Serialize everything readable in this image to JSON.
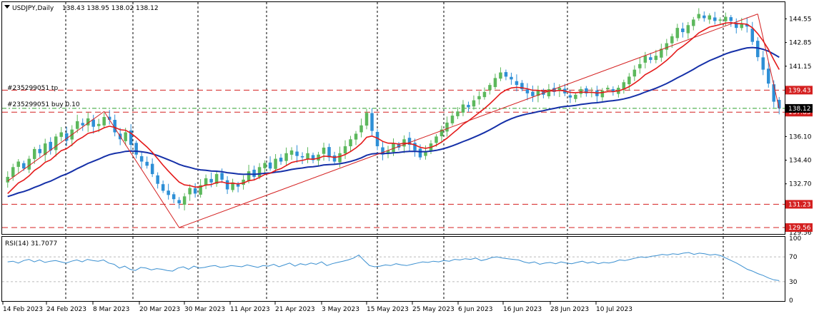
{
  "header": {
    "symbol": "USDJPY,Daily",
    "ohlc": "138.43 138.95 138.02 138.12"
  },
  "orders": {
    "tp_label": "#235299051 tp",
    "buy_label": "#235299051 buy 0.10"
  },
  "colors": {
    "bull": "#5cb85c",
    "bear": "#2e8fd6",
    "ema_fast": "#e41a1a",
    "ema_slow": "#1530a8",
    "trend": "#d42020",
    "level": "#d42020",
    "entry": "#2ca02c",
    "rsi": "#3a8fd0",
    "price_tag_bg": "#d42020"
  },
  "chart_data": [
    {
      "type": "candlestick",
      "symbol": "USDJPY",
      "timeframe": "Daily",
      "y_ticks": [
        "144.55",
        "142.85",
        "141.15",
        "136.10",
        "134.40",
        "132.70"
      ],
      "ylim": [
        129.15,
        145.7
      ],
      "x_labels": [
        "14 Feb 2023",
        "24 Feb 2023",
        "8 Mar 2023",
        "20 Mar 2023",
        "30 Mar 2023",
        "11 Apr 2023",
        "21 Apr 2023",
        "3 May 2023",
        "15 May 2023",
        "25 May 2023",
        "6 Jun 2023",
        "16 Jun 2023",
        "28 Jun 2023",
        "10 Jul 2023"
      ],
      "levels": [
        {
          "label": "139.43",
          "value": 139.43
        },
        {
          "label": "137.85",
          "value": 137.85
        },
        {
          "label": "131.23",
          "value": 131.23
        },
        {
          "label": "129.56",
          "value": 129.56
        }
      ],
      "entry_level": 138.12,
      "current_price": "138.12",
      "grid_label": "129.56",
      "trend_points": [
        {
          "bar": 0,
          "value": 132.9
        },
        {
          "bar": 18,
          "value": 137.9
        },
        {
          "bar": 32,
          "value": 129.56
        },
        {
          "bar": 140,
          "value": 144.9
        },
        {
          "bar": 152,
          "value": 138.1
        }
      ],
      "candles_close": [
        133.2,
        133.9,
        134.3,
        133.8,
        134.5,
        135.2,
        134.9,
        135.6,
        135.1,
        136.1,
        136.4,
        135.8,
        136.6,
        137.2,
        136.9,
        137.4,
        136.8,
        137.0,
        137.5,
        137.3,
        136.4,
        135.9,
        136.4,
        135.5,
        134.8,
        134.3,
        134.0,
        133.4,
        132.7,
        132.2,
        131.9,
        131.6,
        131.3,
        131.8,
        132.4,
        132.0,
        132.6,
        133.1,
        132.8,
        133.4,
        133.0,
        132.3,
        132.8,
        132.5,
        133.0,
        133.6,
        133.2,
        133.9,
        134.2,
        133.8,
        134.5,
        134.3,
        134.9,
        135.1,
        134.7,
        134.6,
        134.9,
        134.4,
        134.8,
        135.3,
        134.6,
        134.3,
        134.9,
        135.4,
        135.9,
        136.3,
        136.9,
        137.8,
        136.5,
        135.4,
        134.8,
        135.1,
        135.6,
        135.3,
        135.9,
        135.5,
        135.1,
        134.6,
        135.0,
        135.6,
        136.1,
        136.6,
        137.1,
        137.6,
        137.9,
        138.4,
        138.2,
        138.7,
        139.0,
        139.3,
        139.8,
        140.3,
        140.7,
        140.4,
        140.2,
        139.8,
        139.5,
        139.2,
        139.0,
        139.4,
        139.1,
        139.5,
        139.3,
        139.6,
        139.2,
        138.9,
        139.1,
        139.5,
        139.2,
        139.3,
        139.0,
        139.4,
        139.6,
        139.3,
        139.6,
        140.0,
        140.4,
        140.9,
        141.3,
        141.9,
        141.6,
        141.9,
        142.4,
        142.8,
        143.3,
        143.9,
        143.6,
        144.1,
        144.5,
        144.9,
        144.6,
        144.8,
        144.4,
        144.5,
        144.7,
        144.4,
        143.9,
        144.2,
        144.0,
        142.9,
        141.8,
        140.9,
        139.9,
        138.6,
        138.12
      ],
      "ema_fast_label": "",
      "ema_slow_label": ""
    },
    {
      "type": "line",
      "name": "RSI(14) 31.7077",
      "y_ticks": [
        "100",
        "70",
        "30",
        "0"
      ],
      "ylim": [
        0,
        100
      ],
      "levels": [
        70,
        30
      ],
      "values": [
        62,
        63,
        60,
        64,
        66,
        62,
        65,
        61,
        63,
        64,
        62,
        60,
        63,
        65,
        62,
        66,
        64,
        63,
        65,
        60,
        58,
        52,
        55,
        50,
        48,
        53,
        52,
        49,
        51,
        50,
        48,
        47,
        52,
        54,
        50,
        55,
        52,
        53,
        55,
        56,
        53,
        54,
        56,
        55,
        54,
        57,
        55,
        53,
        56,
        55,
        58,
        54,
        57,
        60,
        55,
        59,
        57,
        60,
        58,
        62,
        56,
        59,
        61,
        63,
        65,
        68,
        73,
        64,
        56,
        54,
        55,
        57,
        56,
        59,
        57,
        56,
        58,
        60,
        62,
        61,
        63,
        62,
        64,
        63,
        66,
        65,
        67,
        66,
        68,
        64,
        66,
        69,
        70,
        68,
        67,
        66,
        65,
        62,
        60,
        62,
        58,
        60,
        61,
        59,
        62,
        60,
        59,
        61,
        63,
        60,
        62,
        59,
        61,
        60,
        62,
        65,
        64,
        66,
        68,
        70,
        69,
        71,
        72,
        74,
        73,
        75,
        74,
        76,
        77,
        74,
        76,
        75,
        73,
        74,
        72,
        68,
        64,
        60,
        55,
        50,
        47,
        43,
        40,
        36,
        33,
        31.7
      ]
    }
  ]
}
